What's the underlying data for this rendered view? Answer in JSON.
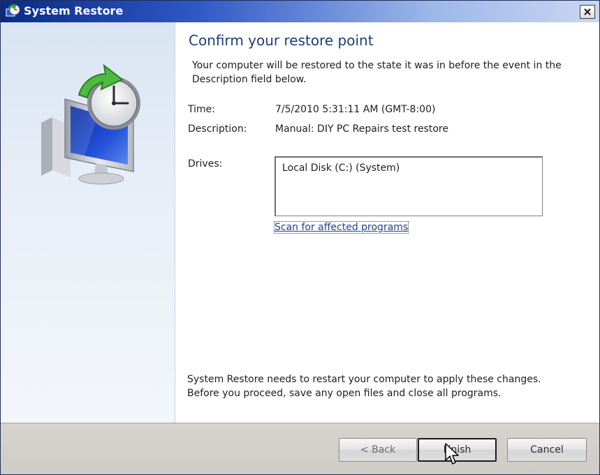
{
  "window": {
    "title": "System Restore",
    "title_icon": "system-restore-icon",
    "close_icon": "close-icon"
  },
  "left_panel": {
    "icon": "system-restore-monitor-clock-icon"
  },
  "content": {
    "heading": "Confirm your restore point",
    "intro": "Your computer will be restored to the state it was in before the event in the Description field below.",
    "time_label": "Time:",
    "time_value": "7/5/2010 5:31:11 AM (GMT-8:00)",
    "description_label": "Description:",
    "description_value": "Manual: DIY PC Repairs test restore",
    "drives_label": "Drives:",
    "drives": [
      "Local Disk (C:) (System)"
    ],
    "scan_link": "Scan for affected programs",
    "notice_line1": "System Restore needs to restart your computer to apply these changes.",
    "notice_line2": "Before you proceed, save any open files and close all programs."
  },
  "buttons": {
    "back": "< Back",
    "finish": "Finish",
    "cancel": "Cancel"
  },
  "colors": {
    "titlebar_start": "#0b2a86",
    "titlebar_end": "#c9d7f1",
    "heading": "#1e3c78",
    "link": "#1c3f95",
    "panel": "#d9e4f2",
    "button_bar": "#d6d3ce"
  }
}
